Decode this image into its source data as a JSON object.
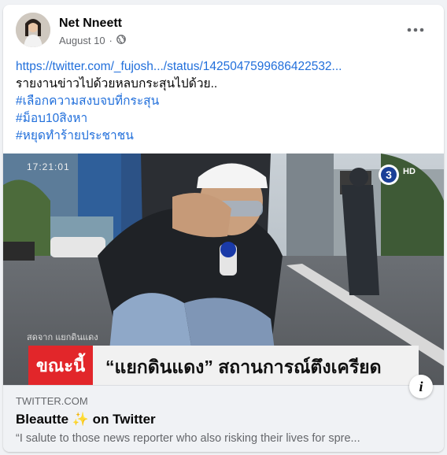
{
  "post": {
    "author": "Net Nneett",
    "date": "August 10",
    "separator": "·",
    "text_lines": [
      "https://twitter.com/_fujosh.../status/1425047599686422532...",
      "รายงานข่าวไปด้วยหลบกระสุนไปด้วย..",
      "#เลือกความสงบจบที่กระสุน",
      "#ม็อบ10สิงหา",
      "#หยุดทำร้ายประชาชน"
    ]
  },
  "icons": {
    "audience": "globe-icon",
    "more": "more-options-icon",
    "info": "info-icon"
  },
  "video": {
    "timestamp": "17:21:01",
    "lower_third_tag": "ขณะนี้",
    "lower_third_text": "“แยกดินแดง” สถานการณ์ตึงเครียด",
    "location_caption": "สดจาก แยกดินแดง",
    "channel": "3",
    "channel_badge": "HD"
  },
  "link_preview": {
    "domain": "TWITTER.COM",
    "title": "Bleautte ✨ on Twitter",
    "description": "“I salute to those news reporter who also risking their lives for spre..."
  },
  "colors": {
    "link": "#216fdb",
    "secondary_text": "#65676b",
    "background": "#f0f2f5",
    "lower_third_red": "#e2262a"
  }
}
